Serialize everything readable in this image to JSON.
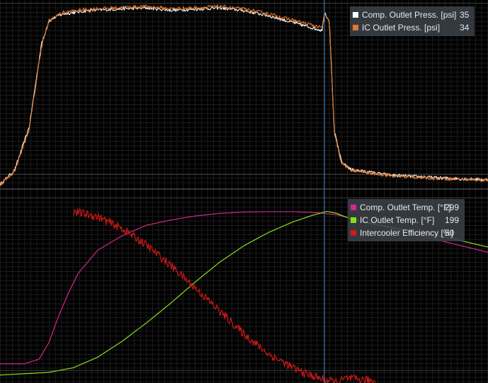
{
  "colors": {
    "background": "#000000",
    "grid_fine": "#1c1c1c",
    "grid_major": "#3a3a3a",
    "cursor": "#4a7fc0",
    "divider": "#6a6a6a"
  },
  "cursor": {
    "x": 0.665
  },
  "chart_data": [
    {
      "type": "line",
      "panel": "top",
      "title": "",
      "xlabel": "",
      "ylabel": "",
      "ylim": [
        0,
        40
      ],
      "xlim": [
        0,
        1
      ],
      "grid": true,
      "legend_position": "top-right",
      "series": [
        {
          "name": "Comp. Outlet Press. [psi]",
          "value": "35",
          "color": "#ffffff",
          "noise": 0.35,
          "x": [
            0,
            0.03,
            0.06,
            0.085,
            0.1,
            0.115,
            0.13,
            0.18,
            0.25,
            0.3,
            0.35,
            0.4,
            0.45,
            0.5,
            0.55,
            0.6,
            0.645,
            0.66,
            0.665,
            0.675,
            0.685,
            0.7,
            0.72,
            0.8,
            0.9,
            1.0
          ],
          "y": [
            0.3,
            3.5,
            13,
            31,
            36,
            37,
            37.6,
            38.3,
            38.7,
            38.9,
            38.4,
            38.6,
            38.9,
            38.3,
            37.2,
            35.7,
            34.4,
            34.0,
            38.0,
            36.0,
            12,
            5.2,
            3.6,
            2.4,
            1.8,
            1.4
          ]
        },
        {
          "name": "IC Outlet Press. [psi]",
          "value": "34",
          "color": "#e07830",
          "noise": 0.4,
          "x": [
            0,
            0.03,
            0.06,
            0.085,
            0.1,
            0.115,
            0.13,
            0.18,
            0.25,
            0.3,
            0.35,
            0.4,
            0.45,
            0.5,
            0.55,
            0.6,
            0.645,
            0.66,
            0.665,
            0.675,
            0.685,
            0.7,
            0.72,
            0.8,
            0.9,
            1.0
          ],
          "y": [
            0.3,
            3.3,
            12.5,
            30.5,
            36,
            37.2,
            37.9,
            38.6,
            39.0,
            39.2,
            38.7,
            38.9,
            39.2,
            38.6,
            37.6,
            36.2,
            35.0,
            34.5,
            37.7,
            35.5,
            11.5,
            5.0,
            3.5,
            2.3,
            1.7,
            1.3
          ]
        }
      ]
    },
    {
      "type": "line",
      "panel": "bottom",
      "title": "",
      "xlabel": "",
      "ylabel": "",
      "ylim": [
        40,
        320
      ],
      "xlim": [
        0,
        1
      ],
      "grid": true,
      "legend_position": "top-right",
      "series": [
        {
          "name": "Comp. Outlet Temp. [°F]",
          "value": "299",
          "color": "#d0288c",
          "noise": 0,
          "x": [
            0,
            0.05,
            0.08,
            0.1,
            0.12,
            0.14,
            0.16,
            0.2,
            0.25,
            0.3,
            0.35,
            0.4,
            0.45,
            0.5,
            0.55,
            0.6,
            0.65,
            0.69,
            0.72,
            0.8,
            0.9,
            1.0
          ],
          "y": [
            68,
            68,
            75,
            100,
            140,
            175,
            205,
            240,
            262,
            278,
            286,
            292,
            296,
            298,
            298.5,
            298.5,
            297,
            294,
            288,
            274,
            255,
            237
          ]
        },
        {
          "name": "IC Outlet Temp.   [°F]",
          "value": "199",
          "color": "#88e018",
          "noise": 0,
          "x": [
            0,
            0.1,
            0.15,
            0.2,
            0.25,
            0.3,
            0.35,
            0.4,
            0.45,
            0.5,
            0.55,
            0.6,
            0.64,
            0.67,
            0.69,
            0.71,
            0.75,
            0.8,
            0.9,
            1.0
          ],
          "y": [
            51,
            55,
            62,
            78,
            102,
            130,
            160,
            192,
            222,
            247,
            267,
            283,
            293,
            299,
            296,
            290,
            282,
            275,
            262,
            245
          ]
        },
        {
          "name": "Intercooler Efficiency [%]",
          "value": "50",
          "color": "#d21818",
          "noise": 0.9,
          "x": [
            0.15,
            0.2,
            0.25,
            0.3,
            0.35,
            0.4,
            0.45,
            0.5,
            0.55,
            0.6,
            0.63,
            0.66,
            0.69,
            0.71,
            0.74,
            0.77
          ],
          "y": [
            299,
            291,
            273,
            248,
            217,
            183,
            148,
            113,
            83,
            62,
            52,
            45,
            40,
            46,
            44,
            42
          ]
        }
      ]
    }
  ]
}
